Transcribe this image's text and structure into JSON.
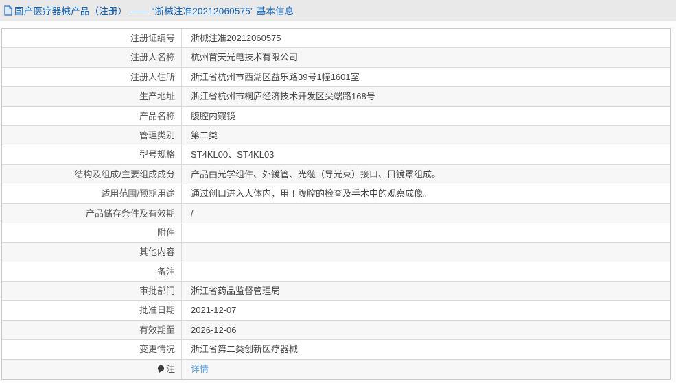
{
  "header": {
    "icon": "document-icon",
    "title": "国产医疗器械产品（注册） —— “浙械注准20212060575” 基本信息"
  },
  "colors": {
    "title_blue": "#0d64b8",
    "link_blue": "#58a0e0",
    "header_bg": "#e9e9e9",
    "row_alt_bg": "#f7f7f7",
    "border": "#d9d9d9"
  },
  "table": {
    "rows": [
      {
        "label": "注册证编号",
        "value": "浙械注准20212060575"
      },
      {
        "label": "注册人名称",
        "value": "杭州首天光电技术有限公司"
      },
      {
        "label": "注册人住所",
        "value": "浙江省杭州市西湖区益乐路39号1幢1601室"
      },
      {
        "label": "生产地址",
        "value": "浙江省杭州市桐庐经济技术开发区尖端路168号"
      },
      {
        "label": "产品名称",
        "value": "腹腔内窥镜"
      },
      {
        "label": "管理类别",
        "value": "第二类"
      },
      {
        "label": "型号规格",
        "value": "ST4KL00、ST4KL03"
      },
      {
        "label": "结构及组成/主要组成成分",
        "value": "产品由光学组件、外镜管、光缆（导光束）接口、目镜罩组成。"
      },
      {
        "label": "适用范围/预期用途",
        "value": "通过创口进入人体内，用于腹腔的检查及手术中的观察成像。"
      },
      {
        "label": "产品储存条件及有效期",
        "value": "/"
      },
      {
        "label": "附件",
        "value": ""
      },
      {
        "label": "其他内容",
        "value": ""
      },
      {
        "label": "备注",
        "value": ""
      },
      {
        "label": "审批部门",
        "value": "浙江省药品监督管理局"
      },
      {
        "label": "批准日期",
        "value": "2021-12-07"
      },
      {
        "label": "有效期至",
        "value": "2026-12-06"
      },
      {
        "label": "变更情况",
        "value": "浙江省第二类创新医疗器械"
      },
      {
        "label": "注",
        "label_icon": "note-bulb-icon",
        "value": "详情",
        "is_link": true
      }
    ]
  }
}
